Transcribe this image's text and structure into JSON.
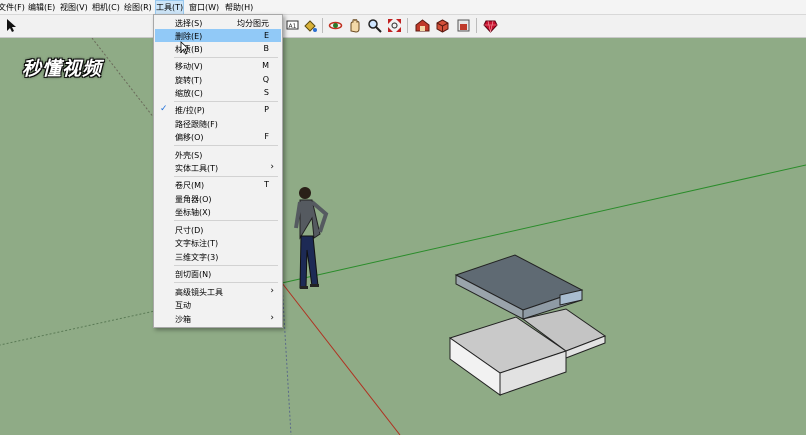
{
  "menubar": {
    "items": [
      {
        "label": "文件(F)"
      },
      {
        "label": "编辑(E)"
      },
      {
        "label": "视图(V)"
      },
      {
        "label": "相机(C)"
      },
      {
        "label": "绘图(R)"
      },
      {
        "label": "工具(T)"
      },
      {
        "label": "窗口(W)"
      },
      {
        "label": "帮助(H)"
      }
    ]
  },
  "watermark": {
    "text": "秒懂视频"
  },
  "toolbar": {
    "buttons": [
      {
        "icon": "select-arrow-icon"
      },
      {
        "icon": "text-label-icon"
      },
      {
        "icon": "paint-bucket-icon"
      },
      {
        "icon": "orbit-icon"
      },
      {
        "icon": "pan-icon"
      },
      {
        "icon": "zoom-icon"
      },
      {
        "icon": "zoom-extents-icon"
      },
      {
        "icon": "warehouse-icon"
      },
      {
        "icon": "components-icon"
      },
      {
        "icon": "share-model-icon"
      },
      {
        "icon": "extension-ruby-icon"
      }
    ]
  },
  "tools_menu": {
    "items": [
      {
        "label": "选择(S)",
        "shortcut": "均分图元"
      },
      {
        "label": "删除(E)",
        "shortcut": "E"
      },
      {
        "label": "材质(B)",
        "shortcut": "B"
      },
      {
        "label": "移动(V)",
        "shortcut": "M"
      },
      {
        "label": "旋转(T)",
        "shortcut": "Q"
      },
      {
        "label": "缩放(C)",
        "shortcut": "S"
      },
      {
        "label": "推/拉(P)",
        "shortcut": "P"
      },
      {
        "label": "路径跟随(F)",
        "shortcut": ""
      },
      {
        "label": "偏移(O)",
        "shortcut": "F"
      },
      {
        "label": "外壳(S)",
        "shortcut": ""
      },
      {
        "label": "实体工具(T)",
        "shortcut": ""
      },
      {
        "label": "卷尺(M)",
        "shortcut": "T"
      },
      {
        "label": "量角器(O)",
        "shortcut": ""
      },
      {
        "label": "坐标轴(X)",
        "shortcut": ""
      },
      {
        "label": "尺寸(D)",
        "shortcut": ""
      },
      {
        "label": "文字标注(T)",
        "shortcut": ""
      },
      {
        "label": "三维文字(3)",
        "shortcut": ""
      },
      {
        "label": "剖切面(N)",
        "shortcut": ""
      },
      {
        "label": "高级镜头工具",
        "shortcut": ""
      },
      {
        "label": "互动",
        "shortcut": ""
      },
      {
        "label": "沙箱",
        "shortcut": ""
      }
    ],
    "highlighted": "删除(E)",
    "checked": "推/拉(P)",
    "submenu_arrow": "›",
    "check_mark": "✓"
  },
  "colors": {
    "ground": "#8fab86",
    "menu_highlight": "#91c9f7",
    "green_axis": "#2a8c2a",
    "red_axis": "#b03020",
    "box_dark": "#5f6a73",
    "box_light": "#c9c9c9"
  }
}
